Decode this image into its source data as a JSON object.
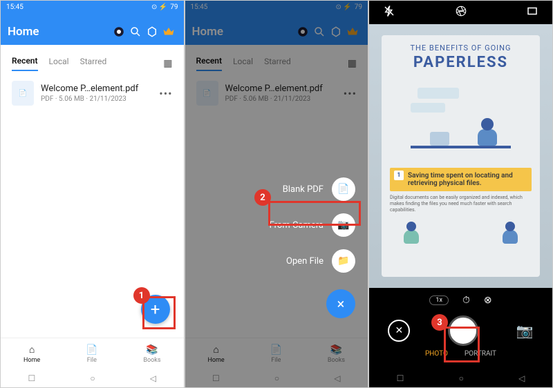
{
  "status": {
    "time": "15:45",
    "battery": "79"
  },
  "header": {
    "title": "Home"
  },
  "tabs": {
    "recent": "Recent",
    "local": "Local",
    "starred": "Starred"
  },
  "file": {
    "name": "Welcome P…element.pdf",
    "meta": "PDF · 5.06 MB · 21/11/2023"
  },
  "nav": {
    "home": "Home",
    "file": "File",
    "books": "Books"
  },
  "fab": {
    "plus": "+",
    "blank": "Blank PDF",
    "camera": "From Camera",
    "open": "Open File",
    "close": "×"
  },
  "callouts": {
    "one": "1",
    "two": "2",
    "three": "3"
  },
  "poster": {
    "line1": "THE BENEFITS OF GOING",
    "line2": "PAPERLESS",
    "point_num": "1",
    "point_text": "Saving time spent on locating and retrieving physical files.",
    "desc": "Digital documents can be easily organized and indexed, which makes finding the files you need much faster with search capabilities."
  },
  "camera": {
    "zoom": "1x",
    "photo": "PHOTO",
    "portrait": "PORTRAIT"
  }
}
